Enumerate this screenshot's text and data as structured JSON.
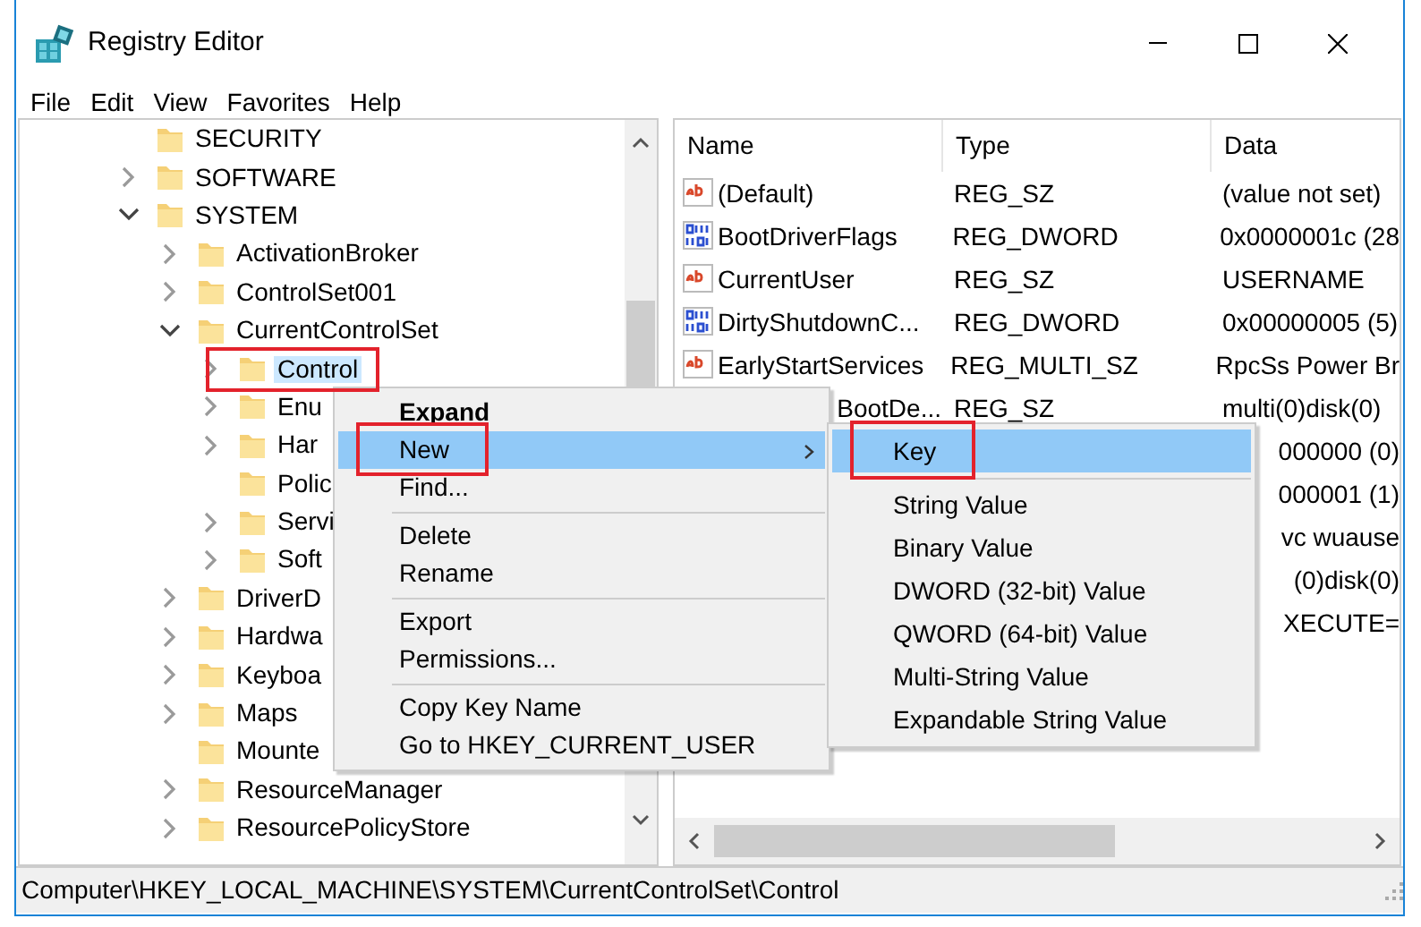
{
  "window": {
    "title": "Registry Editor"
  },
  "menu_bar": [
    "File",
    "Edit",
    "View",
    "Favorites",
    "Help"
  ],
  "tree": [
    {
      "label": "SECURITY",
      "selected": false
    },
    {
      "label": "SOFTWARE",
      "expanded": false,
      "selected": false
    },
    {
      "label": "SYSTEM",
      "expanded": true,
      "selected": false,
      "children": [
        {
          "label": "ActivationBroker",
          "expanded": false,
          "selected": false
        },
        {
          "label": "ControlSet001",
          "expanded": false,
          "selected": false
        },
        {
          "label": "CurrentControlSet",
          "expanded": true,
          "selected": false,
          "children": [
            {
              "label": "Control",
              "expanded": false,
              "selected": true,
              "annotated": true
            },
            {
              "label": "Enu",
              "expanded": false,
              "selected": false
            },
            {
              "label": "Har",
              "expanded": false,
              "selected": false
            },
            {
              "label": "Polic",
              "selected": false
            },
            {
              "label": "Servi",
              "expanded": false,
              "selected": false
            },
            {
              "label": "Soft",
              "expanded": false,
              "selected": false
            }
          ]
        },
        {
          "label": "DriverD",
          "expanded": false,
          "selected": false
        },
        {
          "label": "Hardwa",
          "expanded": false,
          "selected": false
        },
        {
          "label": "Keyboa",
          "expanded": false,
          "selected": false
        },
        {
          "label": "Maps",
          "expanded": false,
          "selected": false
        },
        {
          "label": "Mounte",
          "selected": false
        },
        {
          "label": "ResourceManager",
          "expanded": false,
          "selected": false
        },
        {
          "label": "ResourcePolicyStore",
          "expanded": false,
          "selected": false
        }
      ]
    }
  ],
  "values": {
    "columns": [
      "Name",
      "Type",
      "Data"
    ],
    "rows": [
      {
        "kind": "string",
        "name": "(Default)",
        "type": "REG_SZ",
        "data": "(value not set)"
      },
      {
        "kind": "binary",
        "name": "BootDriverFlags",
        "type": "REG_DWORD",
        "data": "0x0000001c (28"
      },
      {
        "kind": "string",
        "name": "CurrentUser",
        "type": "REG_SZ",
        "data": "USERNAME"
      },
      {
        "kind": "binary",
        "name": "DirtyShutdownC...",
        "type": "REG_DWORD",
        "data": "0x00000005 (5)"
      },
      {
        "kind": "string",
        "name": "EarlyStartServices",
        "type": "REG_MULTI_SZ",
        "data": "RpcSs Power Br"
      },
      {
        "kind": "partial",
        "name": "BootDe...",
        "type": "REG_SZ",
        "data": "multi(0)disk(0)"
      },
      {
        "kind": "partial",
        "data": "000000 (0)"
      },
      {
        "kind": "partial",
        "data": "000001 (1)"
      },
      {
        "kind": "partial",
        "data": "vc wuause"
      },
      {
        "kind": "partial",
        "data": "(0)disk(0)"
      },
      {
        "kind": "partial",
        "data": "XECUTE="
      }
    ]
  },
  "context_menu": {
    "items": [
      {
        "kind": "item",
        "label": "Expand",
        "default": true,
        "selected": false
      },
      {
        "kind": "item",
        "label": "New",
        "submenu": true,
        "selected": true,
        "annotated": true
      },
      {
        "kind": "item",
        "label": "Find...",
        "selected": false
      },
      {
        "kind": "separator"
      },
      {
        "kind": "item",
        "label": "Delete",
        "selected": false
      },
      {
        "kind": "item",
        "label": "Rename",
        "selected": false
      },
      {
        "kind": "separator"
      },
      {
        "kind": "item",
        "label": "Export",
        "selected": false
      },
      {
        "kind": "item",
        "label": "Permissions...",
        "selected": false
      },
      {
        "kind": "separator"
      },
      {
        "kind": "item",
        "label": "Copy Key Name",
        "selected": false
      },
      {
        "kind": "item",
        "label": "Go to HKEY_CURRENT_USER",
        "selected": false
      }
    ]
  },
  "submenu": {
    "items": [
      {
        "kind": "item",
        "label": "Key",
        "selected": true,
        "annotated": true
      },
      {
        "kind": "separator"
      },
      {
        "kind": "item",
        "label": "String Value",
        "selected": false
      },
      {
        "kind": "item",
        "label": "Binary Value",
        "selected": false
      },
      {
        "kind": "item",
        "label": "DWORD (32-bit) Value",
        "selected": false
      },
      {
        "kind": "item",
        "label": "QWORD (64-bit) Value",
        "selected": false
      },
      {
        "kind": "item",
        "label": "Multi-String Value",
        "selected": false
      },
      {
        "kind": "item",
        "label": "Expandable String Value",
        "selected": false
      }
    ]
  },
  "status_bar": "Computer\\HKEY_LOCAL_MACHINE\\SYSTEM\\CurrentControlSet\\Control"
}
